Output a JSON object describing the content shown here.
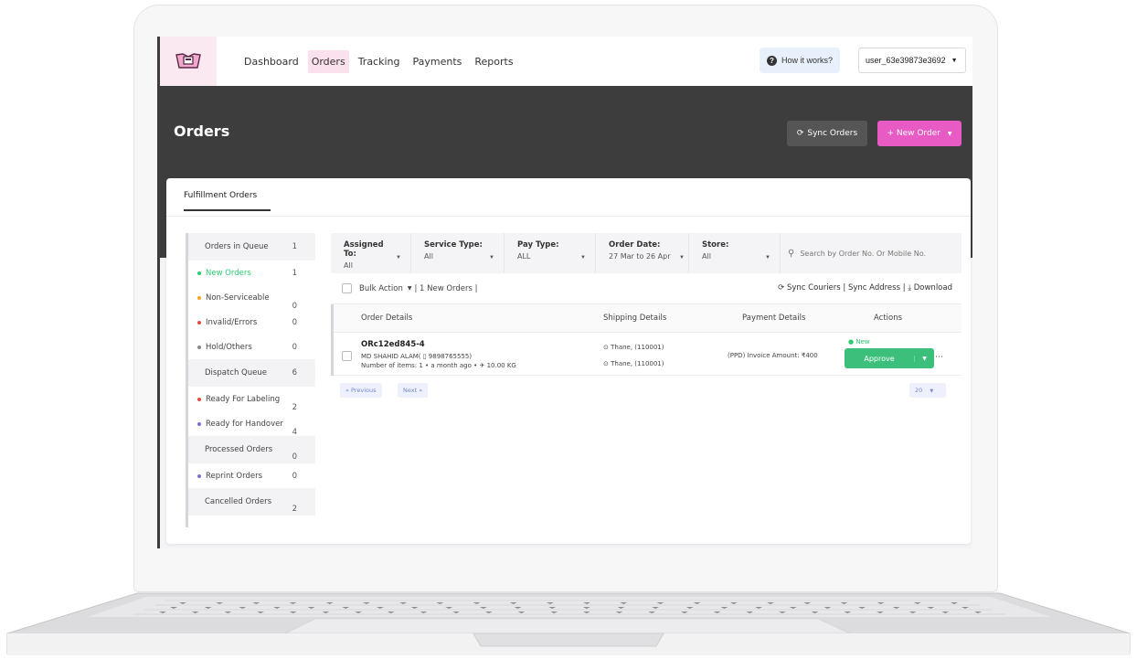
{
  "nav": {
    "links": [
      "Dashboard",
      "Orders",
      "Tracking",
      "Payments",
      "Reports"
    ],
    "how_it_works": "How it works?",
    "user": "user_63e39873e3692"
  },
  "header": {
    "title": "Orders",
    "sync_orders": "Sync Orders",
    "new_order": "+ New Order"
  },
  "tab": "Fulfillment Orders",
  "sidebar": [
    {
      "label": "Orders in Queue",
      "count": "1",
      "type": "group"
    },
    {
      "label": "New Orders",
      "count": "1",
      "type": "item",
      "color": "#2ecc71",
      "active": true
    },
    {
      "label": "Non-Serviceable",
      "count": "0",
      "type": "item",
      "color": "#f5a623"
    },
    {
      "label": "Invalid/Errors",
      "count": "0",
      "type": "item",
      "color": "#e74c3c"
    },
    {
      "label": "Hold/Others",
      "count": "0",
      "type": "item",
      "color": "#888888"
    },
    {
      "label": "Dispatch Queue",
      "count": "6",
      "type": "group"
    },
    {
      "label": "Ready For Labeling",
      "count": "2",
      "type": "item",
      "color": "#e74c3c"
    },
    {
      "label": "Ready for Handover",
      "count": "4",
      "type": "item",
      "color": "#7f6fd1"
    },
    {
      "label": "Processed Orders",
      "count": "0",
      "type": "group"
    },
    {
      "label": "Reprint Orders",
      "count": "0",
      "type": "item",
      "color": "#7f6fd1"
    },
    {
      "label": "Cancelled Orders",
      "count": "2",
      "type": "group"
    }
  ],
  "filters": {
    "assigned_label": "Assigned To:",
    "assigned_value": "All",
    "service_label": "Service Type:",
    "service_value": "All",
    "pay_label": "Pay Type:",
    "pay_value": "ALL",
    "date_label": "Order Date:",
    "date_value": "27 Mar to 26 Apr",
    "store_label": "Store:",
    "store_value": "All",
    "search_placeholder": "Search by Order No. Or Mobile No."
  },
  "bulk": {
    "action": "Bulk Action",
    "info": "| 1 New Orders |",
    "right": "Sync Couriers | Sync Address | ⤓ Download"
  },
  "table": {
    "headers": [
      "Order Details",
      "Shipping Details",
      "Payment Details",
      "Actions"
    ],
    "row": {
      "order_id": "ORc12ed845-4",
      "customer": "MD SHAHID ALAM( ▯ 9898765555)",
      "meta": "Number of items: 1 • a month ago •",
      "weight": "10.00 KG",
      "ship_from": "Thane, (110001)",
      "ship_to": "Thane, (110001)",
      "payment": "(PPD) Invoice Amount: ₹400",
      "status": "New",
      "approve": "Approve"
    }
  },
  "pager": {
    "prev": "« Previous",
    "next": "Next »",
    "per_page": "20"
  }
}
